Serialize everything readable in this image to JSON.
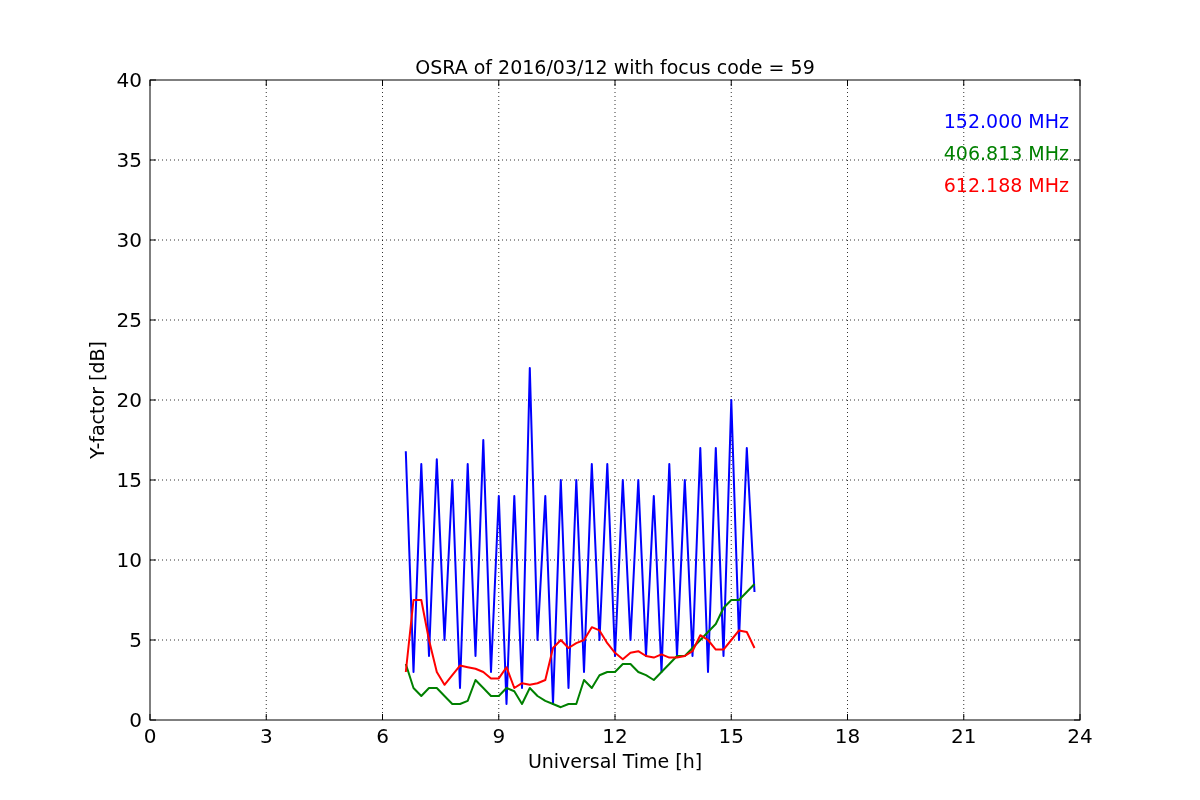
{
  "chart_data": {
    "type": "line",
    "title": "OSRA of 2016/03/12 with focus code = 59",
    "xlabel": "Universal Time [h]",
    "ylabel": "Y-factor [dB]",
    "x": [
      6.6,
      6.8,
      7.0,
      7.2,
      7.4,
      7.6,
      7.8,
      8.0,
      8.2,
      8.4,
      8.6,
      8.8,
      9.0,
      9.2,
      9.4,
      9.6,
      9.8,
      10.0,
      10.2,
      10.4,
      10.6,
      10.8,
      11.0,
      11.2,
      11.4,
      11.6,
      11.8,
      12.0,
      12.2,
      12.4,
      12.6,
      12.8,
      13.0,
      13.2,
      13.4,
      13.6,
      13.8,
      14.0,
      14.2,
      14.4,
      14.6,
      14.8,
      15.0,
      15.2,
      15.4,
      15.6
    ],
    "series": [
      {
        "name": "152.000 MHz",
        "color": "#0000ff",
        "values": [
          16.8,
          3,
          16,
          4,
          16.3,
          5,
          15,
          2,
          16,
          4,
          17.5,
          3,
          14,
          1,
          14,
          2,
          22,
          5,
          14,
          1,
          15,
          2,
          15,
          3,
          16,
          5,
          16,
          4,
          15,
          5,
          15,
          4,
          14,
          3,
          16,
          4,
          15,
          4,
          17,
          3,
          17,
          4,
          20,
          5,
          17,
          8
        ]
      },
      {
        "name": "406.813 MHz",
        "color": "#008000",
        "values": [
          3.5,
          2,
          1.5,
          2,
          2,
          1.5,
          1,
          1,
          1.2,
          2.5,
          2,
          1.5,
          1.5,
          2,
          1.8,
          1,
          2,
          1.5,
          1.2,
          1,
          0.8,
          1,
          1,
          2.5,
          2,
          2.8,
          3,
          3,
          3.5,
          3.5,
          3,
          2.8,
          2.5,
          3,
          3.5,
          4,
          4,
          4.5,
          5,
          5.5,
          6,
          7,
          7.5,
          7.5,
          8,
          8.5
        ]
      },
      {
        "name": "612.188 MHz",
        "color": "#ff0000",
        "values": [
          3,
          7.5,
          7.5,
          5,
          3,
          2.2,
          2.8,
          3.4,
          3.3,
          3.2,
          3,
          2.6,
          2.6,
          3.3,
          2,
          2.3,
          2.2,
          2.3,
          2.5,
          4.5,
          5,
          4.5,
          4.8,
          5,
          5.8,
          5.6,
          4.8,
          4.2,
          3.8,
          4.2,
          4.3,
          4,
          3.9,
          4.1,
          3.9,
          3.9,
          4,
          4.3,
          5.3,
          5,
          4.4,
          4.4,
          5,
          5.6,
          5.5,
          4.5
        ]
      }
    ],
    "xlim": [
      0,
      24
    ],
    "ylim": [
      0,
      40
    ],
    "xticks": [
      0,
      3,
      6,
      9,
      12,
      15,
      18,
      21,
      24
    ],
    "yticks": [
      0,
      5,
      10,
      15,
      20,
      25,
      30,
      35,
      40
    ],
    "grid": true
  }
}
